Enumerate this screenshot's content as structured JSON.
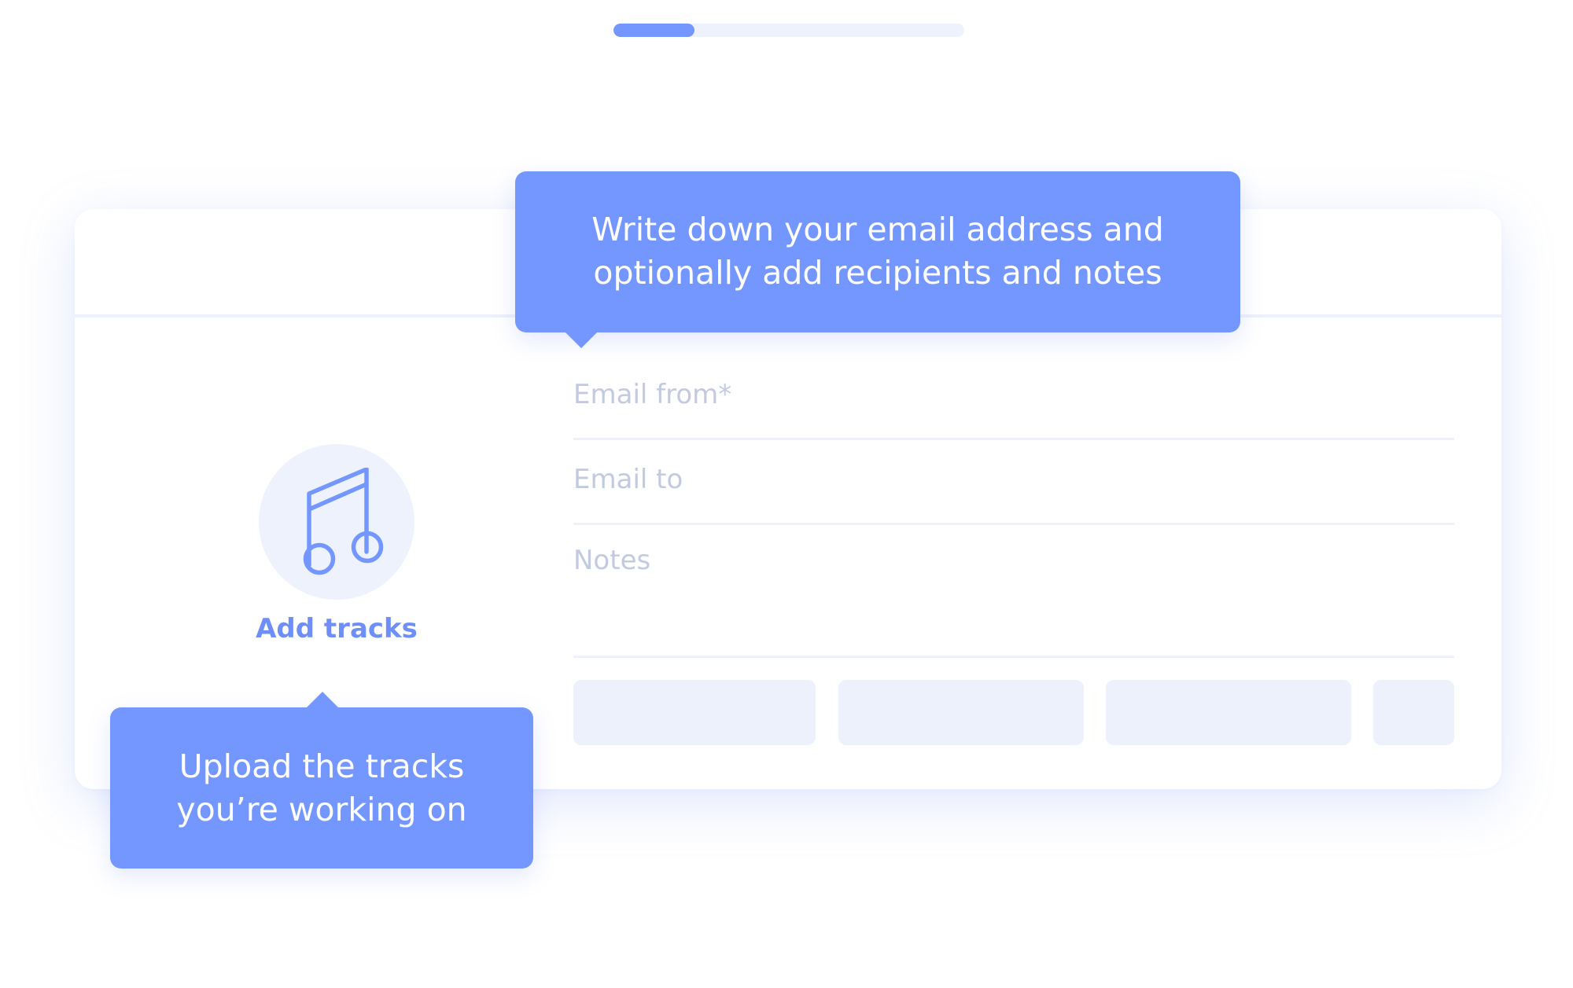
{
  "progress": {
    "fraction": 0.23
  },
  "upload": {
    "add_tracks_label": "Add tracks",
    "icon": "music-note-icon"
  },
  "form": {
    "email_from_placeholder": "Email from*",
    "email_to_placeholder": "Email to",
    "notes_placeholder": "Notes"
  },
  "tooltips": {
    "form_hint": {
      "line1": "Write down your email address and",
      "line2": "optionally add recipients and notes"
    },
    "upload_hint": {
      "line1": "Upload the tracks",
      "line2": "you’re working on"
    }
  },
  "colors": {
    "accent": "#7397ff",
    "accent_label": "#6f8ff8",
    "placeholder_text": "#c3cae0",
    "soft_fill": "#eef2fd"
  }
}
